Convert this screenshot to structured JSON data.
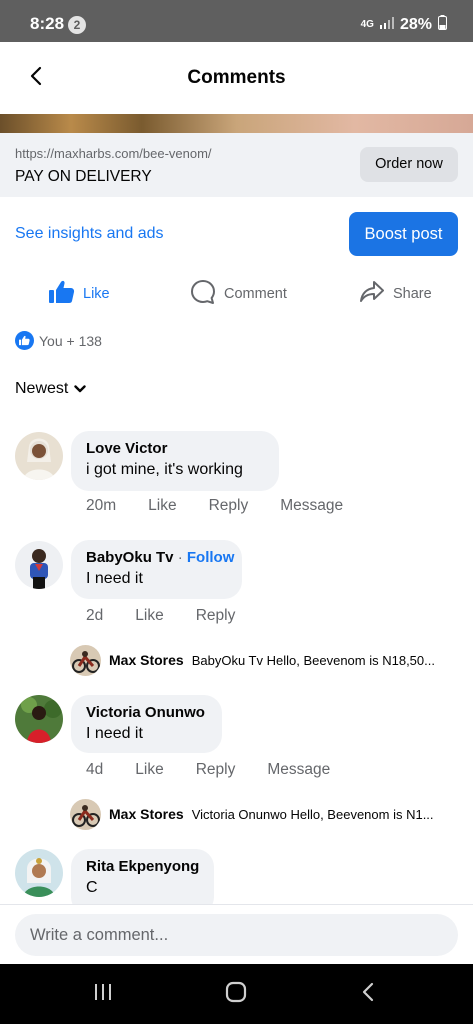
{
  "status_bar": {
    "time": "8:28",
    "notif_count": "2",
    "network": "4G",
    "battery": "28%"
  },
  "header": {
    "title": "Comments"
  },
  "link_card": {
    "url": "https://maxharbs.com/bee-venom/",
    "title": "PAY ON DELIVERY",
    "cta": "Order now"
  },
  "promo": {
    "insights": "See insights and ads",
    "boost": "Boost post"
  },
  "actions": {
    "like": "Like",
    "comment": "Comment",
    "share": "Share"
  },
  "reactions": {
    "summary": "You + 138"
  },
  "sort": {
    "label": "Newest"
  },
  "comments": [
    {
      "name": "Love Victor",
      "follow": "",
      "text": "i got mine, it's working",
      "time": "20m",
      "like": "Like",
      "reply": "Reply",
      "message": "Message"
    },
    {
      "name": "BabyOku Tv",
      "follow": "Follow",
      "text": "I need it",
      "time": "2d",
      "like": "Like",
      "reply": "Reply",
      "message": ""
    },
    {
      "name": "Victoria Onunwo",
      "follow": "",
      "text": "I need it",
      "time": "4d",
      "like": "Like",
      "reply": "Reply",
      "message": "Message"
    },
    {
      "name": "Rita Ekpenyong",
      "follow": "",
      "text": "C",
      "time": "",
      "like": "",
      "reply": "",
      "message": ""
    }
  ],
  "replies": [
    {
      "name": "Max Stores",
      "text": "BabyOku Tv  Hello, Beevenom is N18,50..."
    },
    {
      "name": "Max Stores",
      "text": "Victoria Onunwo  Hello, Beevenom is N1..."
    }
  ],
  "composer": {
    "placeholder": "Write a comment..."
  },
  "colors": {
    "accent": "#1877f2",
    "boost_button": "#1b74e4",
    "bubble": "#f0f2f5",
    "muted_text": "#65676b"
  },
  "icons": [
    "back-arrow-icon",
    "thumbs-up-icon",
    "comment-bubble-icon",
    "share-arrow-icon",
    "chevron-down-icon",
    "recents-icon",
    "home-icon",
    "back-nav-icon"
  ]
}
